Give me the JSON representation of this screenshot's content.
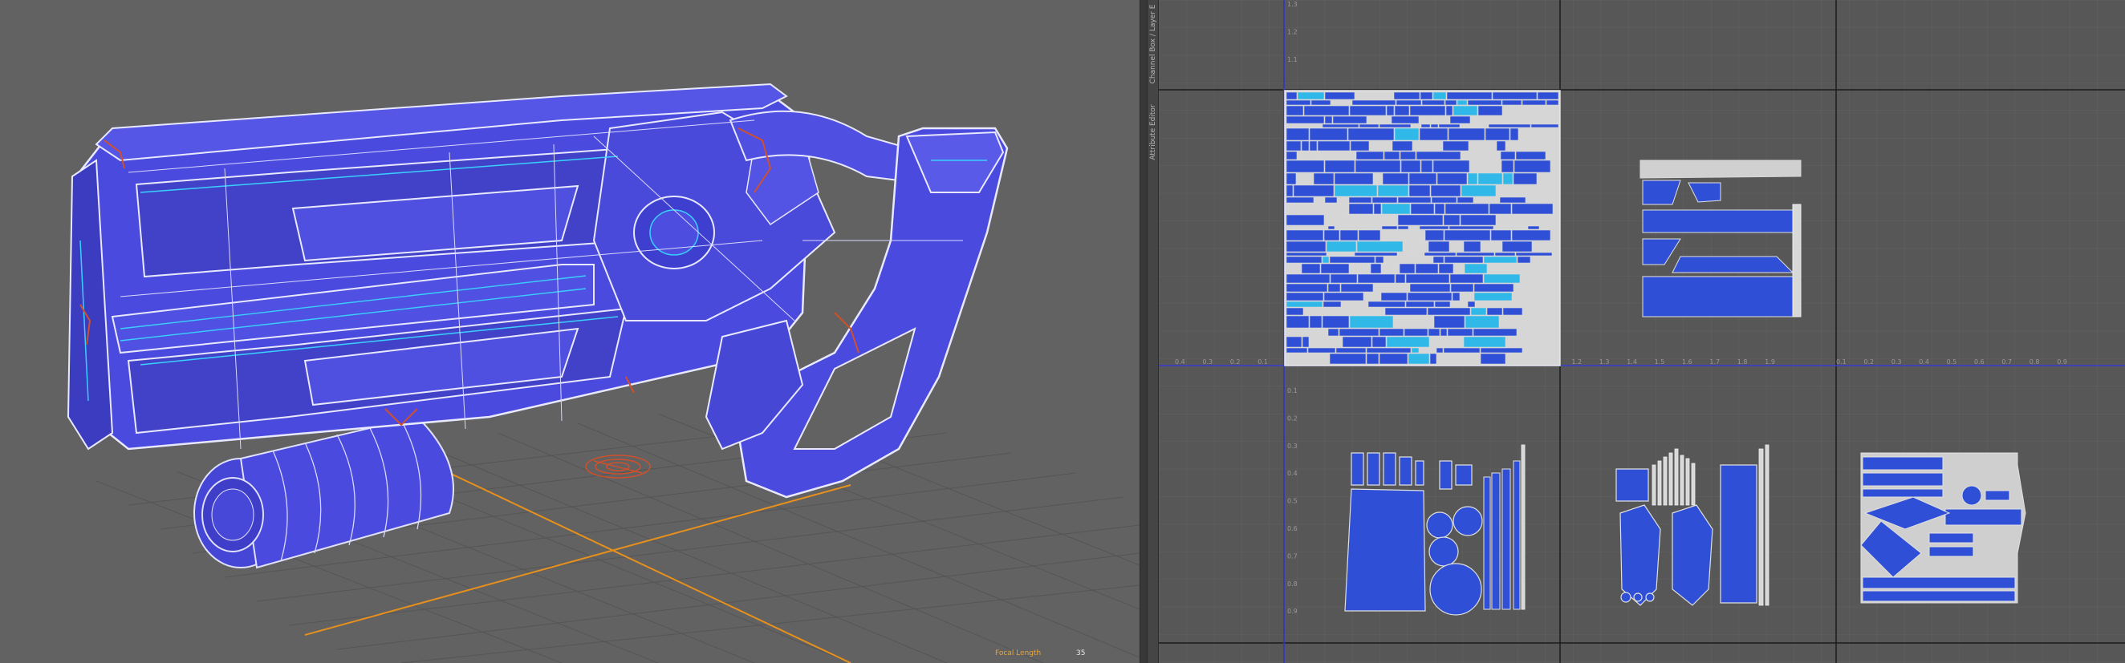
{
  "viewport": {
    "hud": {
      "focal_length_label": "Focal Length",
      "focal_length_value": "35"
    }
  },
  "side_panel": {
    "tabs": [
      {
        "label": "Channel Box / Layer E"
      },
      {
        "label": "Attribute Editor"
      }
    ]
  },
  "uv_editor": {
    "x_ticks_left": [
      "0.4",
      "0.3",
      "0.2",
      "0.1"
    ],
    "x_ticks_mid": [
      "1.1",
      "1.2",
      "1.3",
      "1.4",
      "1.5",
      "1.6",
      "1.7",
      "1.8",
      "1.9"
    ],
    "x_ticks_right": [
      "0.1",
      "0.2",
      "0.3",
      "0.4",
      "0.5",
      "0.6",
      "0.7",
      "0.8",
      "0.9"
    ],
    "y_ticks_top": [
      "1.3",
      "1.2",
      "1.1"
    ],
    "y_ticks_lower": [
      "0.1",
      "0.2",
      "0.3",
      "0.4",
      "0.5",
      "0.6",
      "0.7",
      "0.8",
      "0.9"
    ]
  },
  "colors": {
    "mesh_fill": "#4a4adf",
    "wire": "#d8d8ff",
    "edge_highlight": "#3ad0ff",
    "selected_edges": "#d0502c",
    "grid_axis": "#e8901c",
    "uv_island": "#2f4fd6",
    "uv_border": "#d8d8d8"
  }
}
